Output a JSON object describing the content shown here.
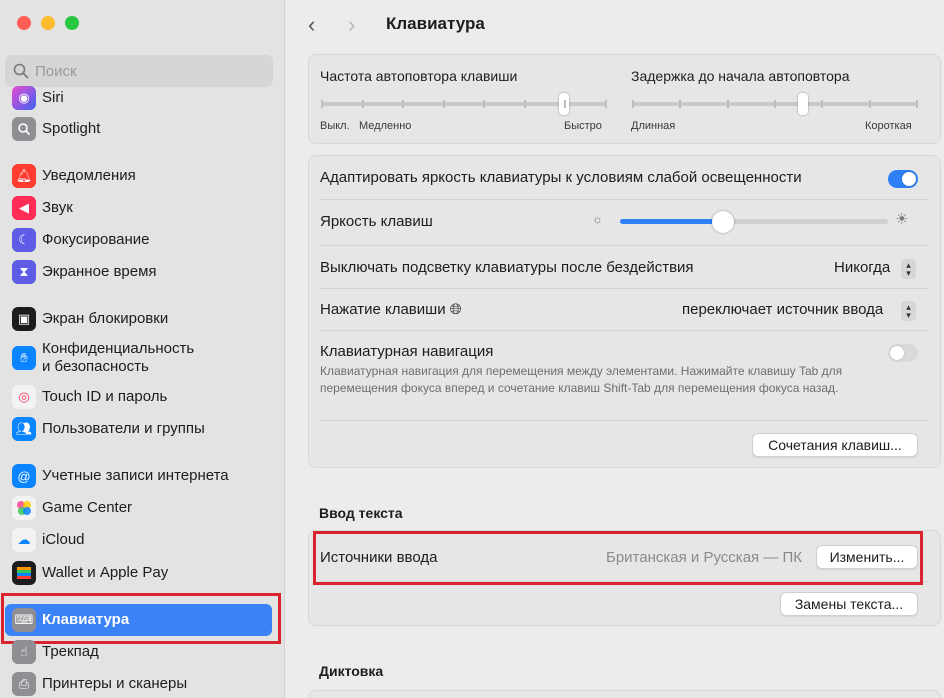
{
  "sidebar": {
    "search_placeholder": "Поиск",
    "items": [
      {
        "label": "Siri",
        "icon": "siri-icon",
        "color": "#6e56cf"
      },
      {
        "label": "Spotlight",
        "icon": "spotlight-icon",
        "color": "#8e8e93"
      },
      {
        "label": "Уведомления",
        "icon": "bell-icon",
        "color": "#ff3b30"
      },
      {
        "label": "Звук",
        "icon": "speaker-icon",
        "color": "#ff2d55"
      },
      {
        "label": "Фокусирование",
        "icon": "moon-icon",
        "color": "#5e5ce6"
      },
      {
        "label": "Экранное время",
        "icon": "hourglass-icon",
        "color": "#5e5ce6"
      },
      {
        "label": "Экран блокировки",
        "icon": "lock-screen-icon",
        "color": "#1c1c1e"
      },
      {
        "label": "Конфиденциальность\nи безопасность",
        "icon": "hand-icon",
        "color": "#0a84ff"
      },
      {
        "label": "Touch ID и пароль",
        "icon": "fingerprint-icon",
        "color": "#f2f2f2"
      },
      {
        "label": "Пользователи и группы",
        "icon": "users-icon",
        "color": "#0a84ff"
      },
      {
        "label": "Учетные записи интернета",
        "icon": "at-icon",
        "color": "#0a84ff"
      },
      {
        "label": "Game Center",
        "icon": "game-center-icon",
        "color": "#f2f2f2"
      },
      {
        "label": "iCloud",
        "icon": "cloud-icon",
        "color": "#f2f2f2"
      },
      {
        "label": "Wallet и Apple Pay",
        "icon": "wallet-icon",
        "color": "#1c1c1e"
      },
      {
        "label": "Клавиатура",
        "icon": "keyboard-icon",
        "color": "#8e8e93"
      },
      {
        "label": "Трекпад",
        "icon": "trackpad-icon",
        "color": "#8e8e93"
      },
      {
        "label": "Принтеры и сканеры",
        "icon": "printer-icon",
        "color": "#8e8e93"
      }
    ]
  },
  "header": {
    "title": "Клавиатура"
  },
  "repeat": {
    "rate_label": "Частота автоповтора клавиши",
    "rate_min": "Выкл.",
    "rate_slow": "Медленно",
    "rate_max": "Быстро",
    "delay_label": "Задержка до начала автоповтора",
    "delay_min": "Длинная",
    "delay_max": "Короткая"
  },
  "settings": {
    "adapt_brightness": "Адаптировать яркость клавиатуры к условиям слабой освещенности",
    "adapt_brightness_on": true,
    "key_brightness": "Яркость клавиш",
    "key_brightness_level": 0.38,
    "backlight_off": "Выключать подсветку клавиатуры после бездействия",
    "backlight_off_value": "Никогда",
    "press_key": "Нажатие клавиши",
    "press_key_value": "переключает источник ввода",
    "kbd_nav": "Клавиатурная навигация",
    "kbd_nav_desc": "Клавиатурная навигация для перемещения между элементами. Нажимайте клавишу Tab для перемещения фокуса вперед и сочетание клавиш Shift-Tab для перемещения фокуса назад.",
    "kbd_nav_on": false,
    "shortcuts_button": "Сочетания клавиш..."
  },
  "text_input": {
    "section_title": "Ввод текста",
    "sources_label": "Источники ввода",
    "sources_value": "Британская и Русская — ПК",
    "change_button": "Изменить...",
    "replacements_button": "Замены текста..."
  },
  "dictation": {
    "section_title": "Диктовка"
  },
  "colors": {
    "accent": "#2f7ff5",
    "highlight": "#d9232f"
  }
}
